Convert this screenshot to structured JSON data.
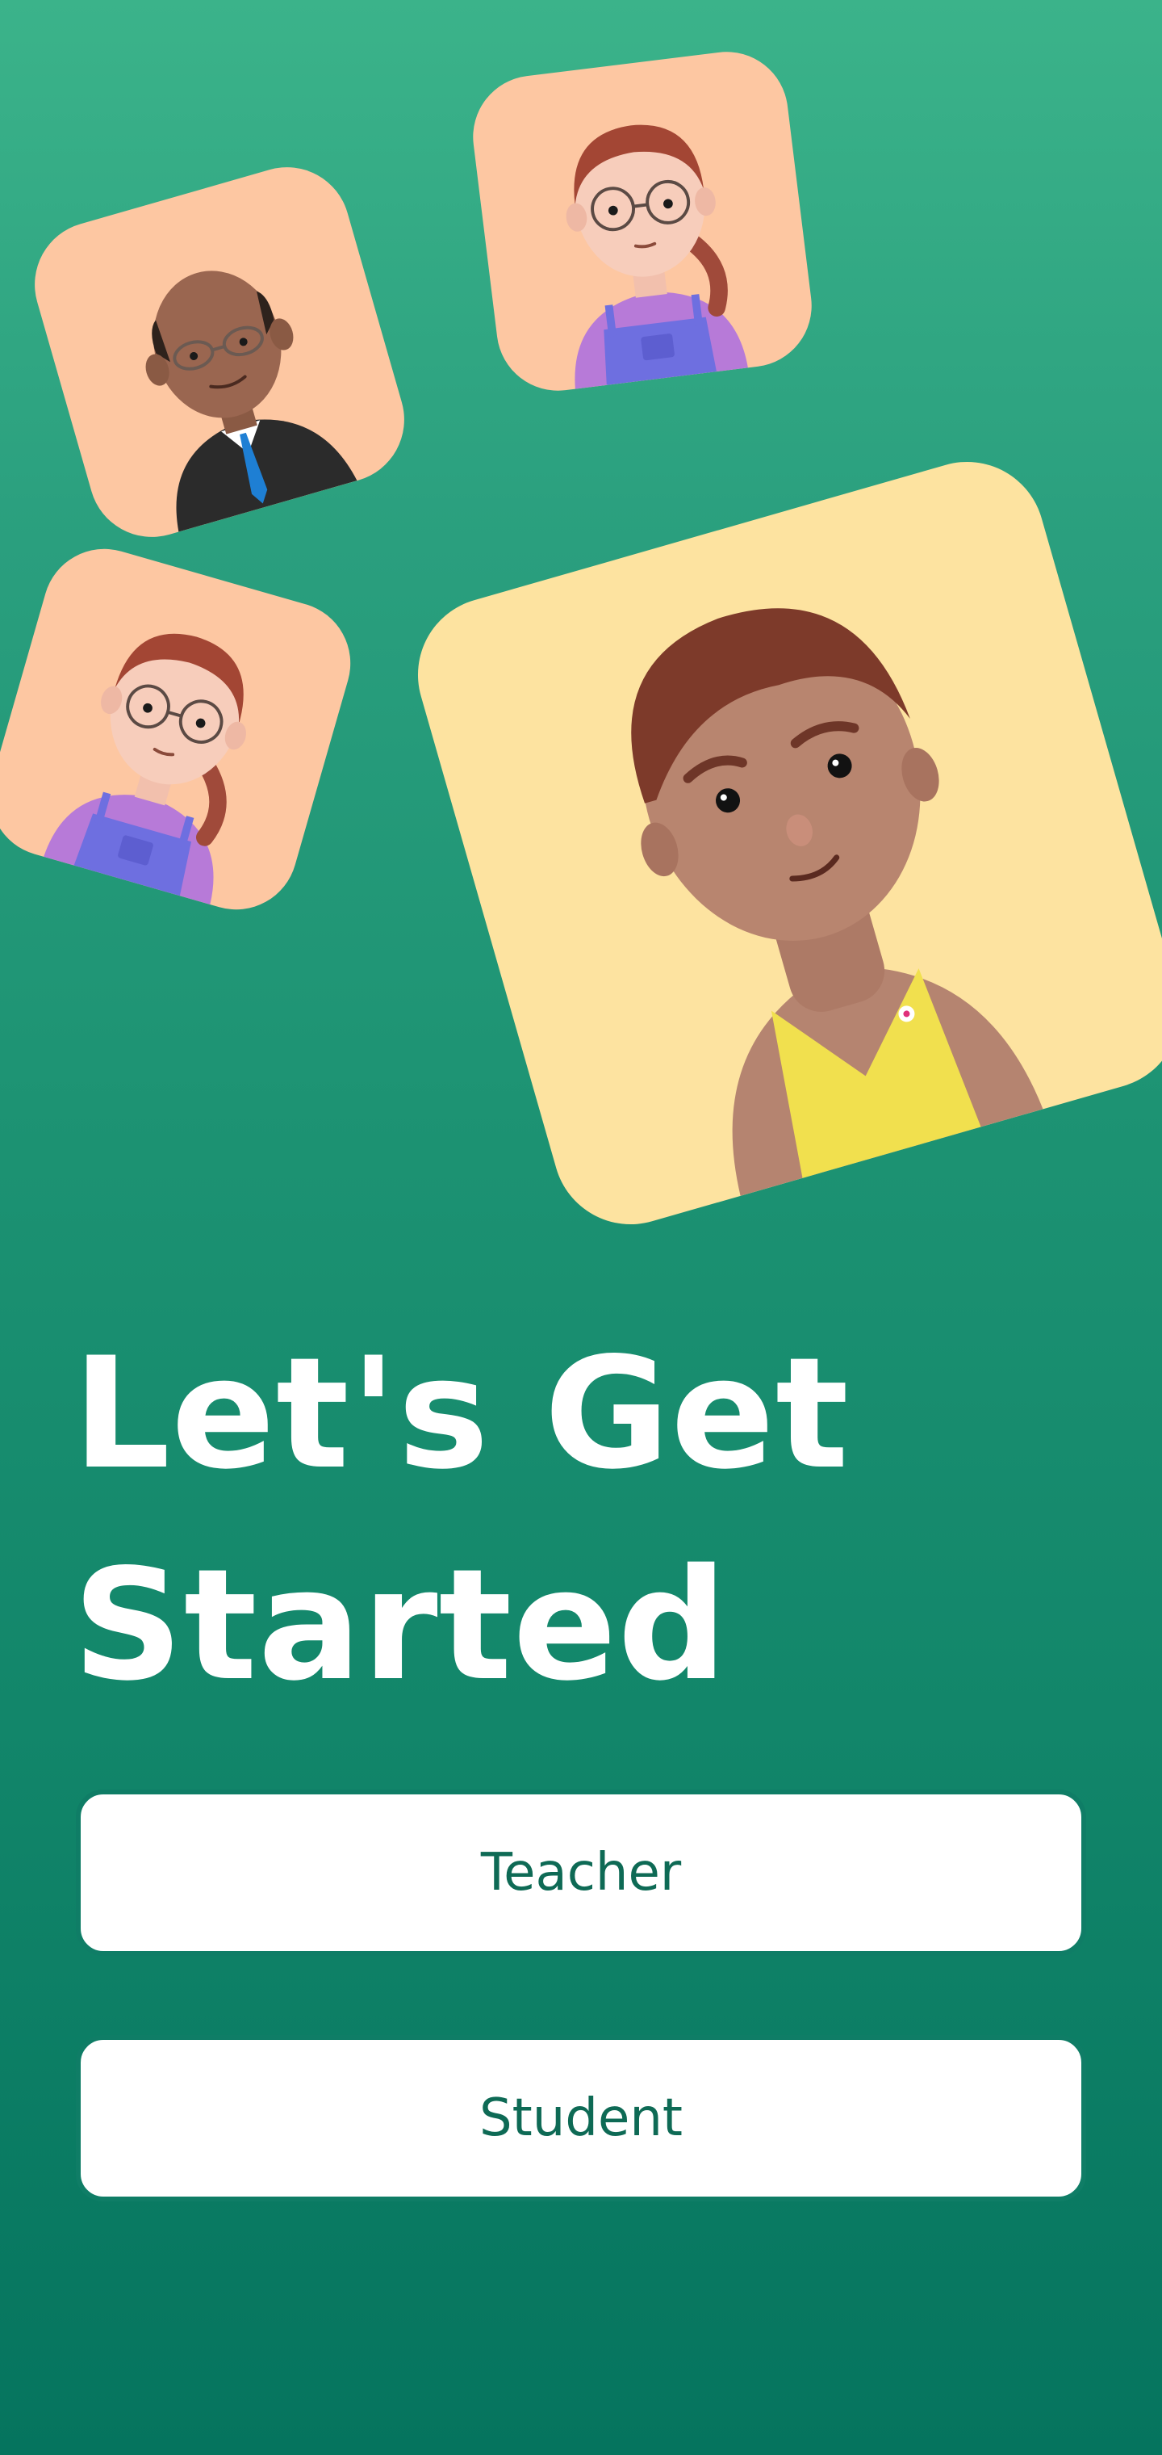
{
  "screen": {
    "title": "Let's Get Started"
  },
  "avatars": [
    {
      "name": "bald man in suit with glasses",
      "tile_color": "#fdc7a2"
    },
    {
      "name": "girl with glasses and purple overalls",
      "tile_color": "#fdc7a2"
    },
    {
      "name": "girl with glasses and purple overalls",
      "tile_color": "#fdc7a2"
    },
    {
      "name": "boy in yellow top",
      "tile_color": "#fde3a0"
    }
  ],
  "buttons": {
    "teacher_label": "Teacher",
    "student_label": "Student"
  },
  "colors": {
    "background_top": "#3bb38a",
    "background_bottom": "#05745e",
    "button_text": "#0e6a55",
    "button_bg": "#ffffff"
  }
}
